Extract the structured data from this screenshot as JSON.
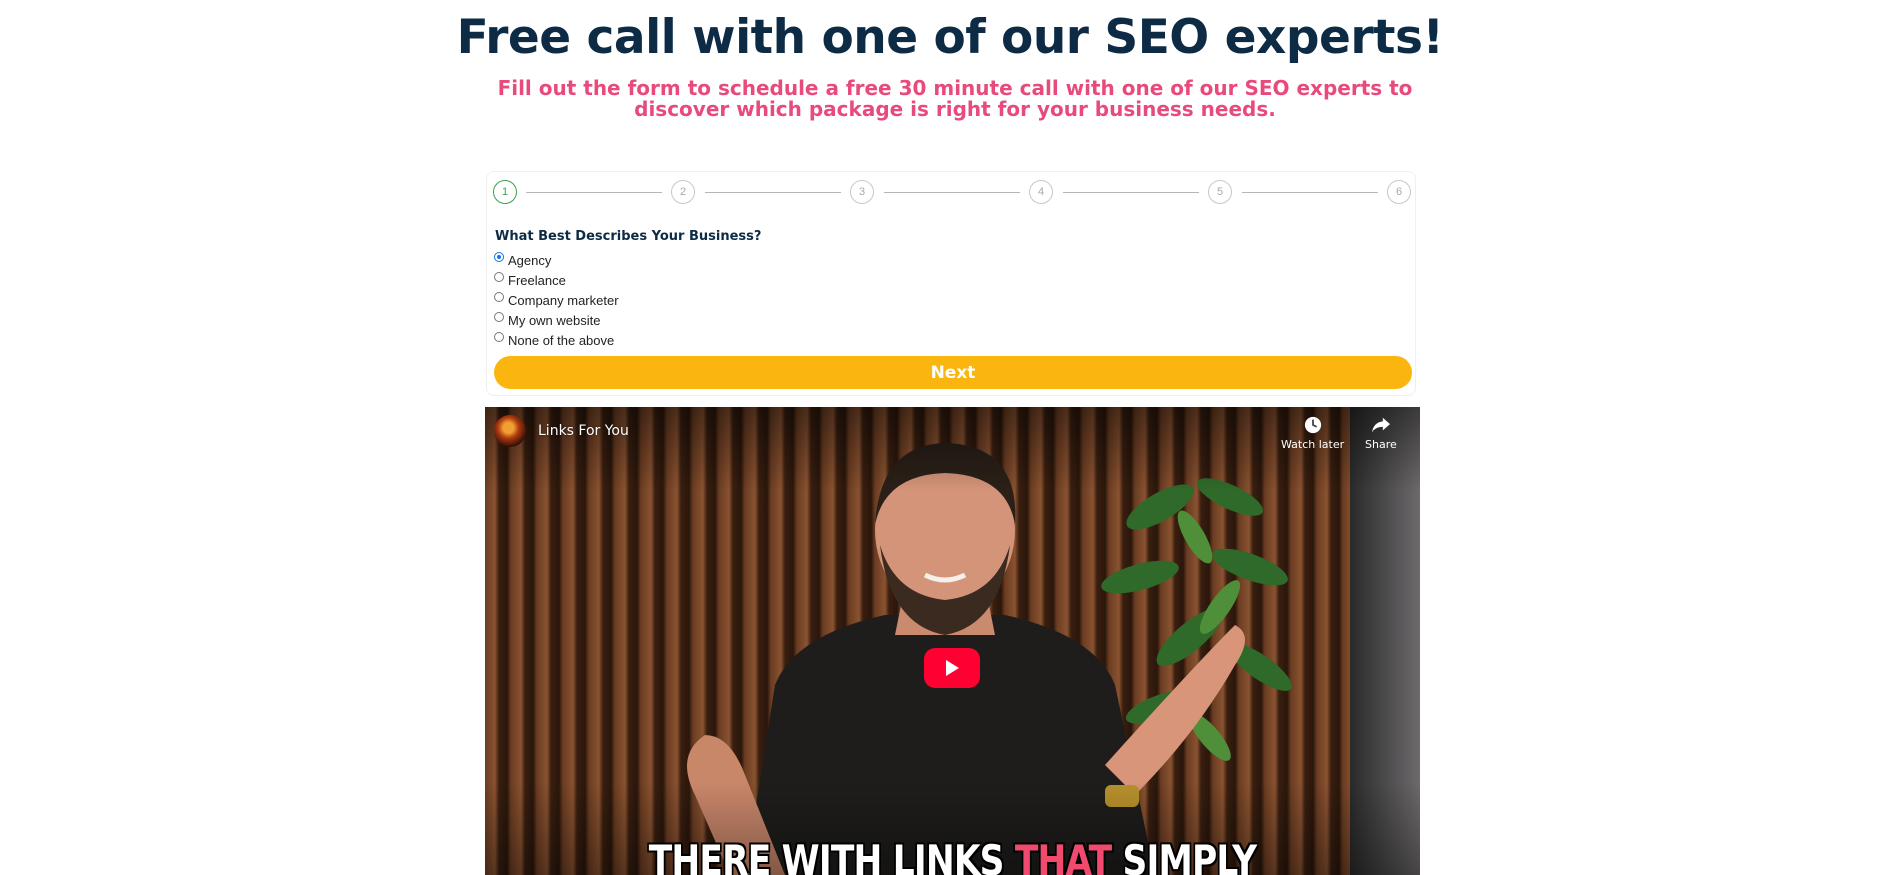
{
  "header": {
    "title": "Free call with one of our SEO experts!",
    "subtitle": "Fill out the form to schedule a free 30 minute call with one of our SEO experts to discover which package is right for your business needs."
  },
  "form": {
    "steps": [
      "1",
      "2",
      "3",
      "4",
      "5",
      "6"
    ],
    "current_step": 1,
    "question": "What Best Describes Your Business?",
    "options": [
      "Agency",
      "Freelance",
      "Company marketer",
      "My own website",
      "None of the above"
    ],
    "selected_option": "Agency",
    "next_label": "Next"
  },
  "video": {
    "channel_name": "Links For You",
    "watch_later_label": "Watch later",
    "share_label": "Share",
    "caption_before": "THERE WITH LINKS ",
    "caption_highlight": "THAT",
    "caption_after": " SIMPLY"
  },
  "colors": {
    "title": "#0d2b45",
    "subtitle": "#e84a7c",
    "button": "#fbb50f",
    "active_step": "#3aa14a",
    "youtube_red": "#ff0033"
  }
}
